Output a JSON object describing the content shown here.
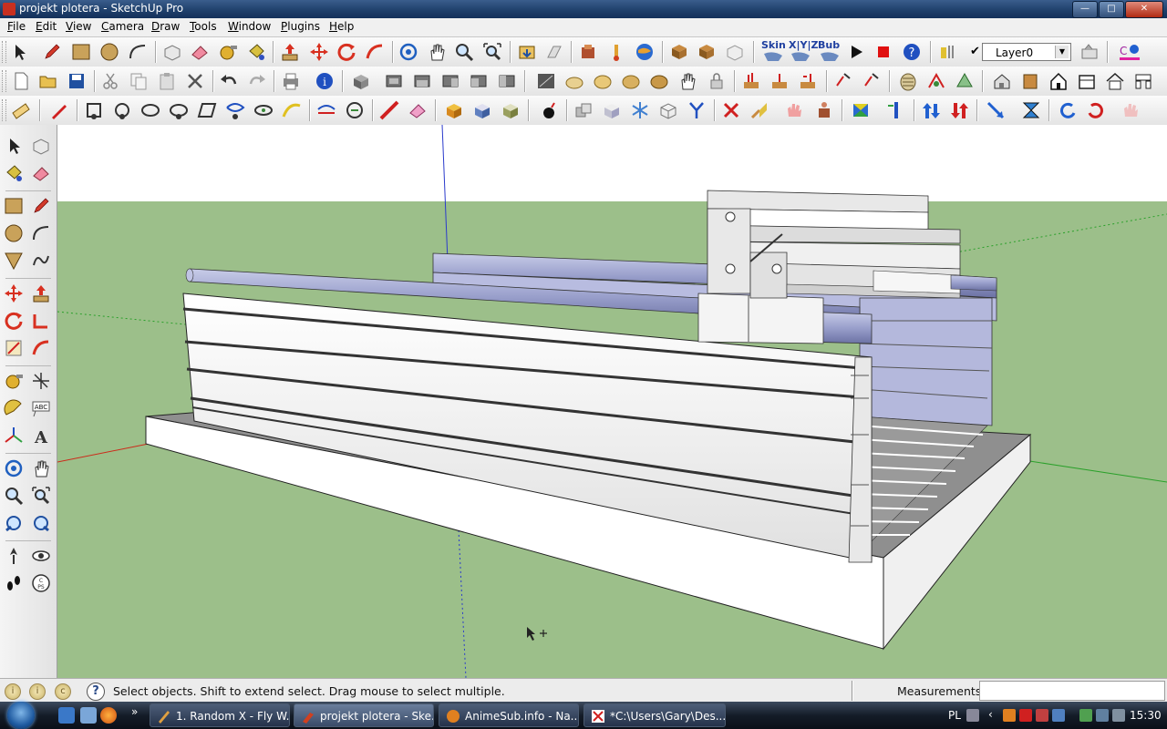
{
  "window": {
    "title": "projekt plotera - SketchUp Pro",
    "controls": [
      "minimize",
      "maximize",
      "close"
    ]
  },
  "menubar": [
    {
      "label": "File",
      "key": "F",
      "rest": "ile"
    },
    {
      "label": "Edit",
      "key": "E",
      "rest": "dit"
    },
    {
      "label": "View",
      "key": "V",
      "rest": "iew"
    },
    {
      "label": "Camera",
      "key": "C",
      "rest": "amera"
    },
    {
      "label": "Draw",
      "key": "D",
      "rest": "raw"
    },
    {
      "label": "Tools",
      "key": "T",
      "rest": "ools"
    },
    {
      "label": "Window",
      "key": "W",
      "rest": "indow"
    },
    {
      "label": "Plugins",
      "key": "P",
      "rest": "lugins"
    },
    {
      "label": "Help",
      "key": "H",
      "rest": "elp"
    }
  ],
  "toolbar": {
    "skin_label": "Skin",
    "xyz_label": "X|Y|Z",
    "bub_label": "Bub",
    "layer_value": "Layer0"
  },
  "status": {
    "hint": "Select objects. Shift to extend select. Drag mouse to select multiple.",
    "measurements_label": "Measurements",
    "measurements_value": "",
    "icons": [
      "i",
      "i",
      "c"
    ],
    "help": "?"
  },
  "taskbar": {
    "tasks": [
      {
        "label": "1. Random X - Fly W..."
      },
      {
        "label": "projekt plotera - Ske..."
      },
      {
        "label": "AnimeSub.info - Na..."
      },
      {
        "label": "*C:\\Users\\Gary\\Des..."
      }
    ],
    "lang": "PL",
    "clock": "15:30"
  },
  "colors": {
    "sky": "#ffffff",
    "ground": "#9cbf8a",
    "axis_red": "#cc2a1a",
    "axis_green": "#2aa02a",
    "axis_blue": "#2a3acc"
  }
}
